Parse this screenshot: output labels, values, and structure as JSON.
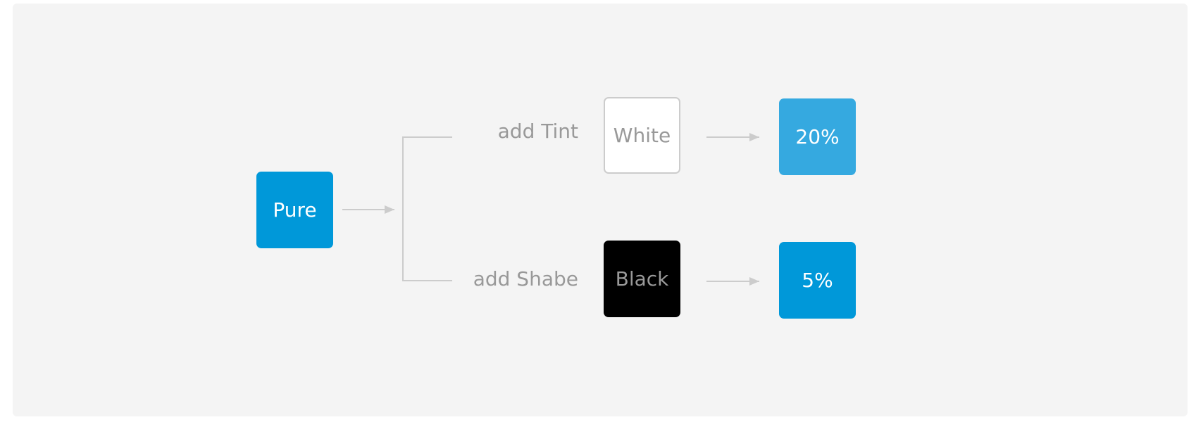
{
  "nodes": {
    "pure": {
      "label": "Pure",
      "color": "#0098d9"
    },
    "white": {
      "label": "White",
      "color": "#ffffff"
    },
    "black": {
      "label": "Black",
      "color": "#000000"
    },
    "tint_result": {
      "label": "20%",
      "color": "#35a9e0"
    },
    "shade_result": {
      "label": "5%",
      "color": "#0098d9"
    }
  },
  "branches": {
    "tint": "add Tint",
    "shade": "add Shabe"
  },
  "colors": {
    "background": "#f4f4f4",
    "connector": "#cccccc",
    "label_text": "#999999"
  }
}
